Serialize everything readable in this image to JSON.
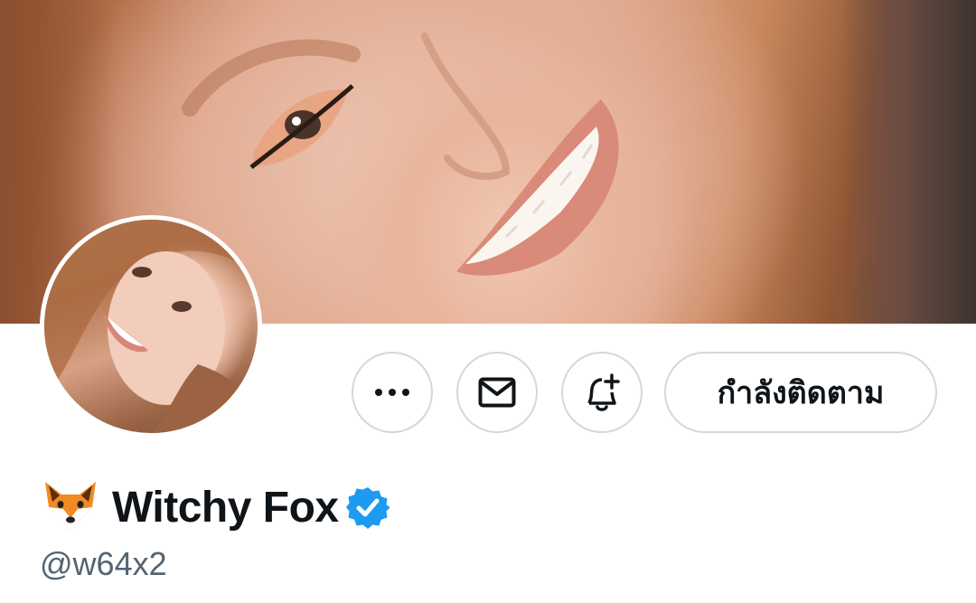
{
  "profile": {
    "display_name": "Witchy Fox",
    "name_emoji": "fox-face-icon",
    "verified_icon": "verified-badge-icon",
    "verified_color": "#1d9bf0",
    "handle": "@w64x2"
  },
  "actions": {
    "more_icon": "ellipsis-icon",
    "message_icon": "envelope-icon",
    "notify_icon": "bell-plus-icon",
    "follow_label": "กำลังติดตาม"
  },
  "colors": {
    "text_primary": "#0f1419",
    "text_secondary": "#536471",
    "button_border": "#cfd9de"
  }
}
